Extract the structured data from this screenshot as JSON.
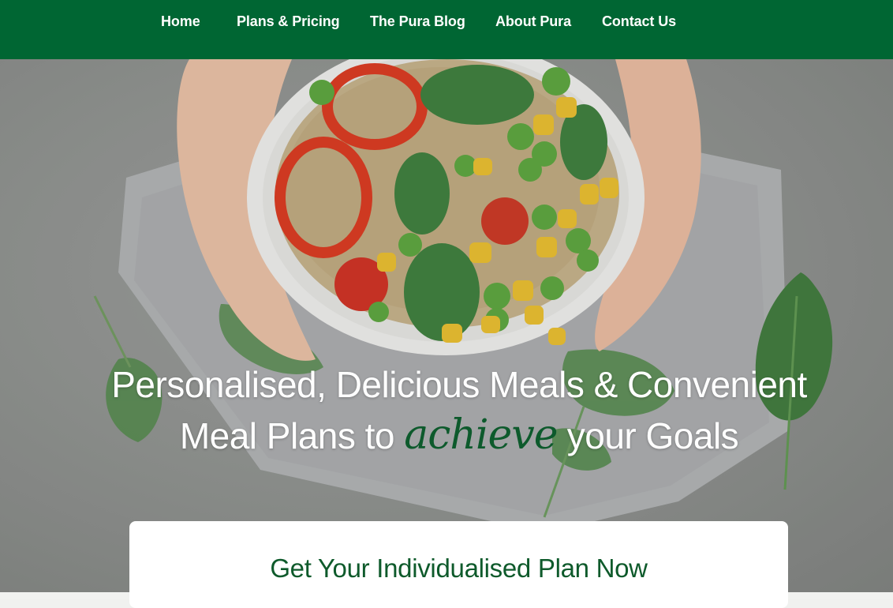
{
  "nav": {
    "items": [
      {
        "label": "Home"
      },
      {
        "label": "Plans & Pricing"
      },
      {
        "label": "The Pura Blog"
      },
      {
        "label": "About Pura"
      },
      {
        "label": "Contact Us"
      }
    ]
  },
  "hero": {
    "headline_line1": "Personalised, Delicious Meals & Convenient",
    "headline_line2_before": "Meal Plans to ",
    "headline_accent": "achieve",
    "headline_line2_after": " your Goals"
  },
  "card": {
    "title": "Get Your Individualised Plan Now"
  },
  "colors": {
    "brand_green": "#006633",
    "accent_green": "#0d5a2c",
    "card_title_green": "#0e5a2b"
  }
}
